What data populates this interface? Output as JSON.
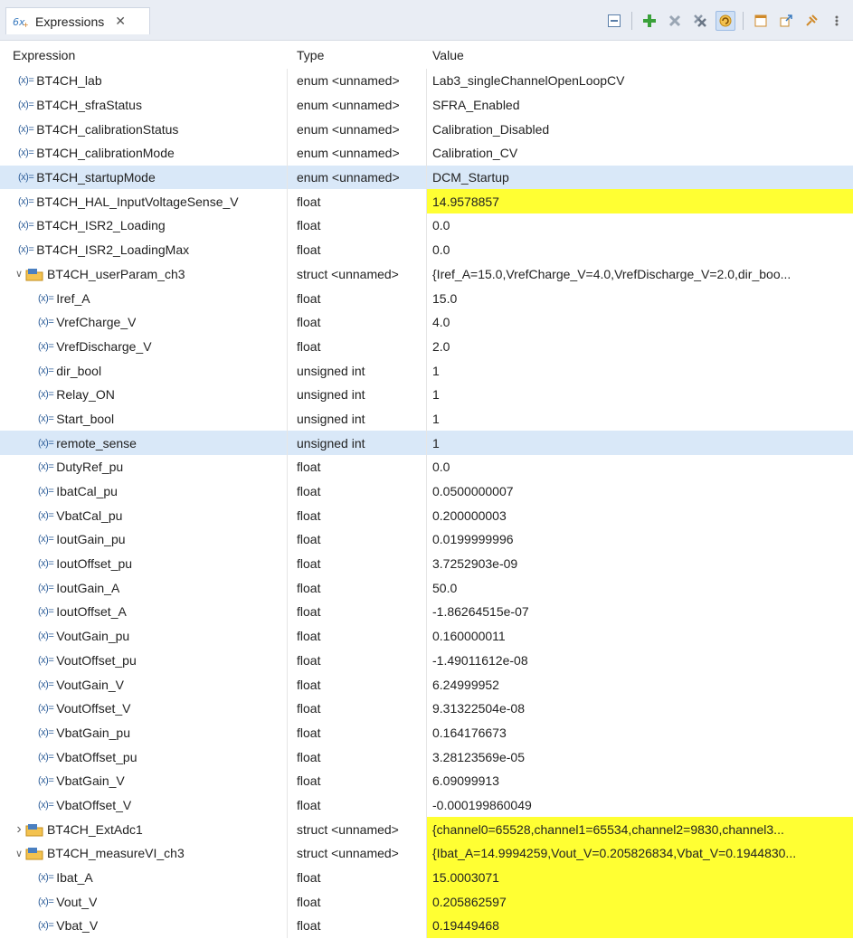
{
  "tab": {
    "title": "Expressions",
    "close": "✕"
  },
  "columns": {
    "expression": "Expression",
    "type": "Type",
    "value": "Value"
  },
  "colors": {
    "highlight": "#ffff33",
    "selected_row": "#d9e8f8"
  },
  "rows": [
    {
      "name": "BT4CH_lab",
      "type": "enum <unnamed>",
      "value": "Lab3_singleChannelOpenLoopCV",
      "level": 0,
      "kind": "var",
      "highlight": false,
      "selected": false
    },
    {
      "name": "BT4CH_sfraStatus",
      "type": "enum <unnamed>",
      "value": "SFRA_Enabled",
      "level": 0,
      "kind": "var",
      "highlight": false,
      "selected": false
    },
    {
      "name": "BT4CH_calibrationStatus",
      "type": "enum <unnamed>",
      "value": "Calibration_Disabled",
      "level": 0,
      "kind": "var",
      "highlight": false,
      "selected": false
    },
    {
      "name": "BT4CH_calibrationMode",
      "type": "enum <unnamed>",
      "value": "Calibration_CV",
      "level": 0,
      "kind": "var",
      "highlight": false,
      "selected": false
    },
    {
      "name": "BT4CH_startupMode",
      "type": "enum <unnamed>",
      "value": "DCM_Startup",
      "level": 0,
      "kind": "var",
      "highlight": false,
      "selected": true
    },
    {
      "name": "BT4CH_HAL_InputVoltageSense_V",
      "type": "float",
      "value": "14.9578857",
      "level": 0,
      "kind": "var",
      "highlight": true,
      "selected": false
    },
    {
      "name": "BT4CH_ISR2_Loading",
      "type": "float",
      "value": "0.0",
      "level": 0,
      "kind": "var",
      "highlight": false,
      "selected": false
    },
    {
      "name": "BT4CH_ISR2_LoadingMax",
      "type": "float",
      "value": "0.0",
      "level": 0,
      "kind": "var",
      "highlight": false,
      "selected": false
    },
    {
      "name": "BT4CH_userParam_ch3",
      "type": "struct <unnamed>",
      "value": "{Iref_A=15.0,VrefCharge_V=4.0,VrefDischarge_V=2.0,dir_boo...",
      "level": 0,
      "kind": "struct-open",
      "highlight": false,
      "selected": false
    },
    {
      "name": "Iref_A",
      "type": "float",
      "value": "15.0",
      "level": 1,
      "kind": "var",
      "highlight": false,
      "selected": false
    },
    {
      "name": "VrefCharge_V",
      "type": "float",
      "value": "4.0",
      "level": 1,
      "kind": "var",
      "highlight": false,
      "selected": false
    },
    {
      "name": "VrefDischarge_V",
      "type": "float",
      "value": "2.0",
      "level": 1,
      "kind": "var",
      "highlight": false,
      "selected": false
    },
    {
      "name": "dir_bool",
      "type": "unsigned int",
      "value": "1",
      "level": 1,
      "kind": "var",
      "highlight": false,
      "selected": false
    },
    {
      "name": "Relay_ON",
      "type": "unsigned int",
      "value": "1",
      "level": 1,
      "kind": "var",
      "highlight": false,
      "selected": false
    },
    {
      "name": "Start_bool",
      "type": "unsigned int",
      "value": "1",
      "level": 1,
      "kind": "var",
      "highlight": false,
      "selected": false
    },
    {
      "name": "remote_sense",
      "type": "unsigned int",
      "value": "1",
      "level": 1,
      "kind": "var",
      "highlight": false,
      "selected": true
    },
    {
      "name": "DutyRef_pu",
      "type": "float",
      "value": "0.0",
      "level": 1,
      "kind": "var",
      "highlight": false,
      "selected": false
    },
    {
      "name": "IbatCal_pu",
      "type": "float",
      "value": "0.0500000007",
      "level": 1,
      "kind": "var",
      "highlight": false,
      "selected": false
    },
    {
      "name": "VbatCal_pu",
      "type": "float",
      "value": "0.200000003",
      "level": 1,
      "kind": "var",
      "highlight": false,
      "selected": false
    },
    {
      "name": "IoutGain_pu",
      "type": "float",
      "value": "0.0199999996",
      "level": 1,
      "kind": "var",
      "highlight": false,
      "selected": false
    },
    {
      "name": "IoutOffset_pu",
      "type": "float",
      "value": "3.7252903e-09",
      "level": 1,
      "kind": "var",
      "highlight": false,
      "selected": false
    },
    {
      "name": "IoutGain_A",
      "type": "float",
      "value": "50.0",
      "level": 1,
      "kind": "var",
      "highlight": false,
      "selected": false
    },
    {
      "name": "IoutOffset_A",
      "type": "float",
      "value": "-1.86264515e-07",
      "level": 1,
      "kind": "var",
      "highlight": false,
      "selected": false
    },
    {
      "name": "VoutGain_pu",
      "type": "float",
      "value": "0.160000011",
      "level": 1,
      "kind": "var",
      "highlight": false,
      "selected": false
    },
    {
      "name": "VoutOffset_pu",
      "type": "float",
      "value": "-1.49011612e-08",
      "level": 1,
      "kind": "var",
      "highlight": false,
      "selected": false
    },
    {
      "name": "VoutGain_V",
      "type": "float",
      "value": "6.24999952",
      "level": 1,
      "kind": "var",
      "highlight": false,
      "selected": false
    },
    {
      "name": "VoutOffset_V",
      "type": "float",
      "value": "9.31322504e-08",
      "level": 1,
      "kind": "var",
      "highlight": false,
      "selected": false
    },
    {
      "name": "VbatGain_pu",
      "type": "float",
      "value": "0.164176673",
      "level": 1,
      "kind": "var",
      "highlight": false,
      "selected": false
    },
    {
      "name": "VbatOffset_pu",
      "type": "float",
      "value": "3.28123569e-05",
      "level": 1,
      "kind": "var",
      "highlight": false,
      "selected": false
    },
    {
      "name": "VbatGain_V",
      "type": "float",
      "value": "6.09099913",
      "level": 1,
      "kind": "var",
      "highlight": false,
      "selected": false
    },
    {
      "name": "VbatOffset_V",
      "type": "float",
      "value": "-0.000199860049",
      "level": 1,
      "kind": "var",
      "highlight": false,
      "selected": false
    },
    {
      "name": "BT4CH_ExtAdc1",
      "type": "struct <unnamed>",
      "value": "{channel0=65528,channel1=65534,channel2=9830,channel3...",
      "level": 0,
      "kind": "struct-closed",
      "highlight": true,
      "selected": false
    },
    {
      "name": "BT4CH_measureVI_ch3",
      "type": "struct <unnamed>",
      "value": "{Ibat_A=14.9994259,Vout_V=0.205826834,Vbat_V=0.1944830...",
      "level": 0,
      "kind": "struct-open",
      "highlight": true,
      "selected": false
    },
    {
      "name": "Ibat_A",
      "type": "float",
      "value": "15.0003071",
      "level": 1,
      "kind": "var",
      "highlight": true,
      "selected": false
    },
    {
      "name": "Vout_V",
      "type": "float",
      "value": "0.205862597",
      "level": 1,
      "kind": "var",
      "highlight": true,
      "selected": false
    },
    {
      "name": "Vbat_V",
      "type": "float",
      "value": "0.19449468",
      "level": 1,
      "kind": "var",
      "highlight": true,
      "selected": false
    }
  ]
}
